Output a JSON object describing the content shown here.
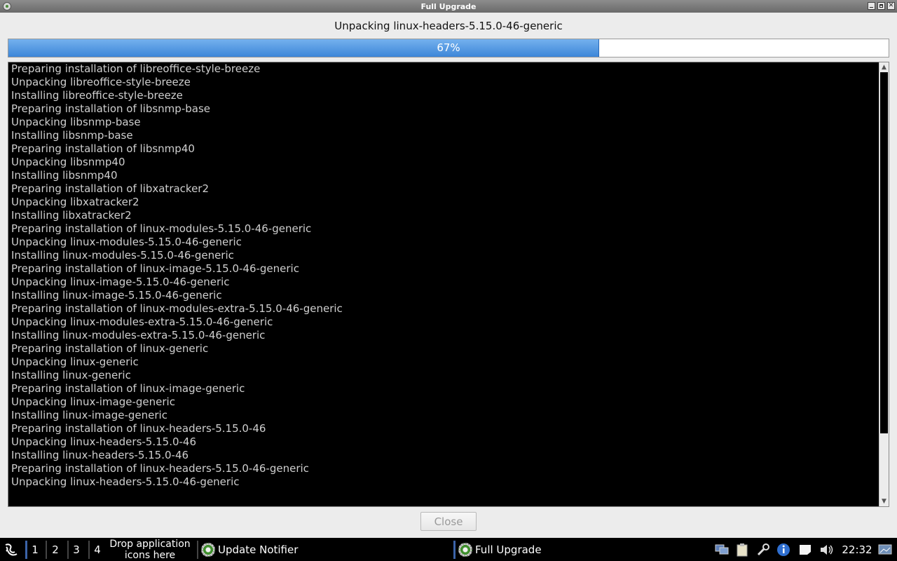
{
  "window": {
    "title": "Full Upgrade"
  },
  "status": {
    "text": "Unpacking linux-headers-5.15.0-46-generic"
  },
  "progress": {
    "value_percent": 67,
    "label": "67%",
    "fill_color": "#3d86d8"
  },
  "terminal": {
    "background": "#000000",
    "text_color": "#cfcfcf",
    "lines": [
      "Preparing installation of libreoffice-style-breeze",
      "Unpacking libreoffice-style-breeze",
      "Installing libreoffice-style-breeze",
      "Preparing installation of libsnmp-base",
      "Unpacking libsnmp-base",
      "Installing libsnmp-base",
      "Preparing installation of libsnmp40",
      "Unpacking libsnmp40",
      "Installing libsnmp40",
      "Preparing installation of libxatracker2",
      "Unpacking libxatracker2",
      "Installing libxatracker2",
      "Preparing installation of linux-modules-5.15.0-46-generic",
      "Unpacking linux-modules-5.15.0-46-generic",
      "Installing linux-modules-5.15.0-46-generic",
      "Preparing installation of linux-image-5.15.0-46-generic",
      "Unpacking linux-image-5.15.0-46-generic",
      "Installing linux-image-5.15.0-46-generic",
      "Preparing installation of linux-modules-extra-5.15.0-46-generic",
      "Unpacking linux-modules-extra-5.15.0-46-generic",
      "Installing linux-modules-extra-5.15.0-46-generic",
      "Preparing installation of linux-generic",
      "Unpacking linux-generic",
      "Installing linux-generic",
      "Preparing installation of linux-image-generic",
      "Unpacking linux-image-generic",
      "Installing linux-image-generic",
      "Preparing installation of linux-headers-5.15.0-46",
      "Unpacking linux-headers-5.15.0-46",
      "Installing linux-headers-5.15.0-46",
      "Preparing installation of linux-headers-5.15.0-46-generic",
      "Unpacking linux-headers-5.15.0-46-generic"
    ]
  },
  "buttons": {
    "close_label": "Close"
  },
  "taskbar": {
    "menu_icon": "lxqt-menu-icon",
    "desktops": [
      "1",
      "2",
      "3",
      "4"
    ],
    "drop_line1": "Drop application",
    "drop_line2": "icons here",
    "tasks": [
      {
        "label": "Update Notifier",
        "icon": "update-gear-icon"
      },
      {
        "label": "Full Upgrade",
        "icon": "update-gear-icon"
      }
    ],
    "tray_icons": [
      "network-icon",
      "clipboard-icon",
      "tools-icon",
      "info-icon",
      "notes-icon",
      "volume-icon"
    ],
    "clock": "22:32",
    "accent_color": "#3b63a8"
  }
}
